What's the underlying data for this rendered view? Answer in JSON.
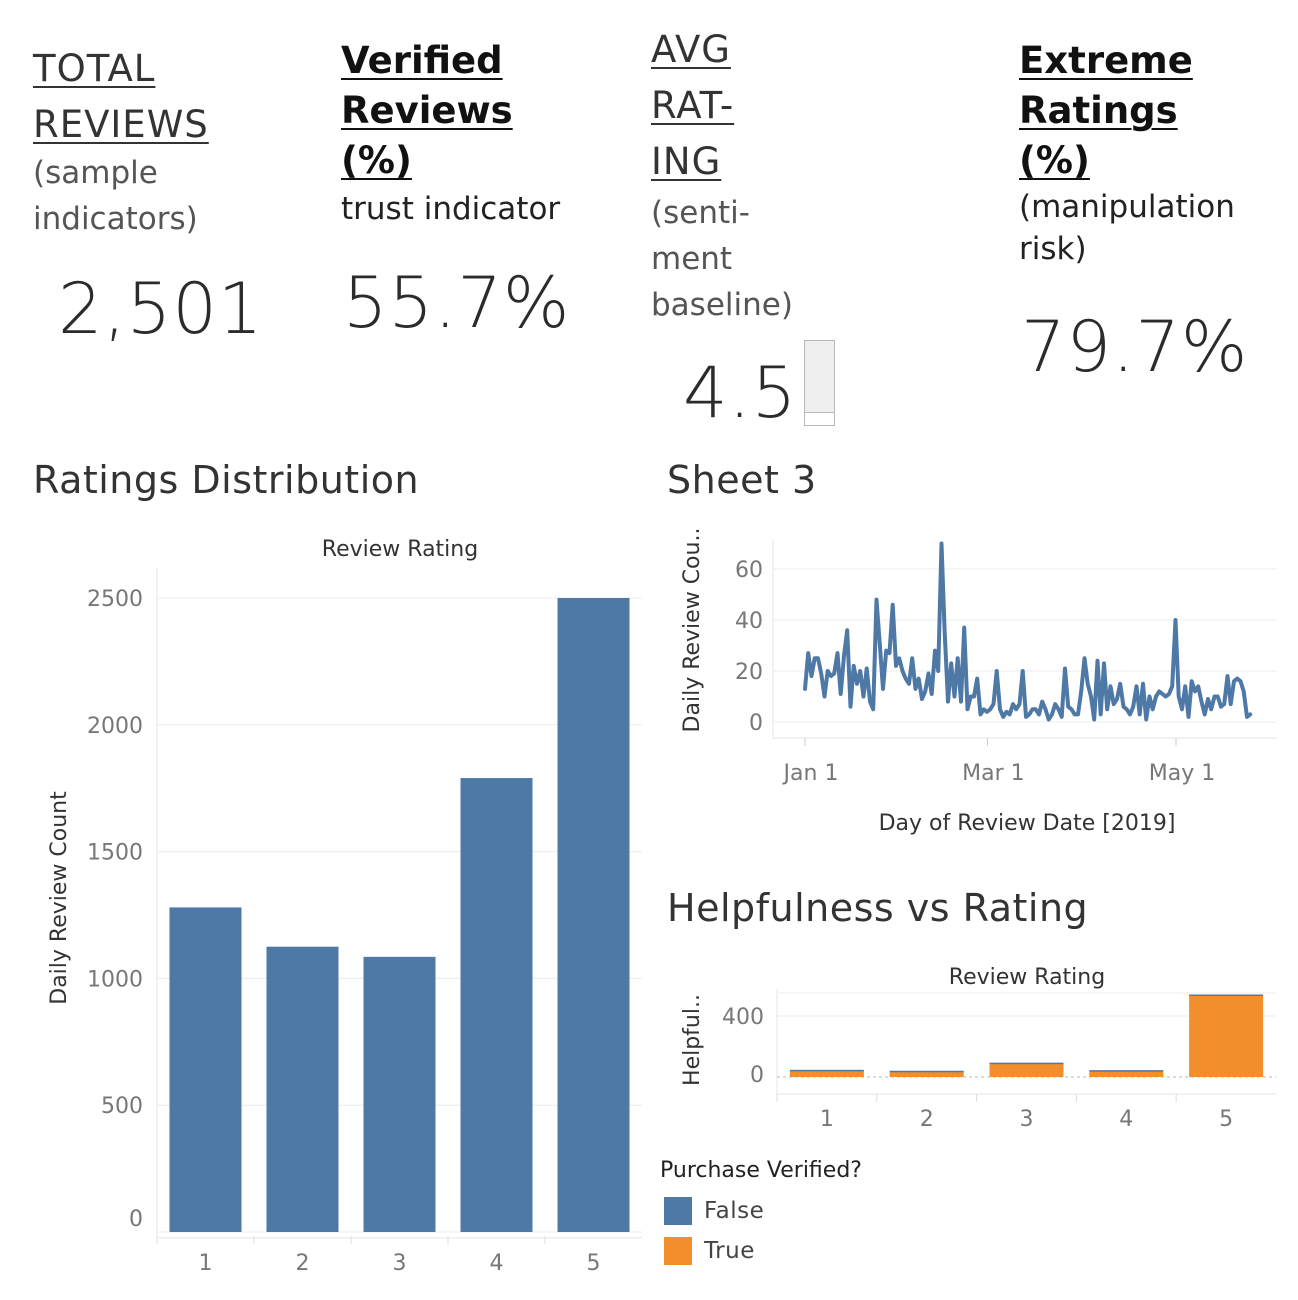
{
  "kpis": {
    "total": {
      "title_1": "TOTAL",
      "title_2": "REVIEWS",
      "sub_1": "(sample",
      "sub_2": "indicators)",
      "value": "2,501"
    },
    "verified": {
      "title_1": "Verified",
      "title_2": "Reviews",
      "title_3": "(%)",
      "sub_1": "trust indicator",
      "value": "55.7%"
    },
    "avg": {
      "title_1": "AVG",
      "title_2": "RAT-",
      "title_3": "ING",
      "sub_1": "(senti-",
      "sub_2": "ment",
      "sub_3": "baseline)",
      "value": "4.5"
    },
    "extreme": {
      "title_1": "Extreme",
      "title_2": "Ratings",
      "title_3": "(%)",
      "sub_1": "(manipulation",
      "sub_2": "risk)",
      "value": "79.7%"
    }
  },
  "sheets": {
    "ratings_title": "Ratings Distribution",
    "sheet3_title": "Sheet 3",
    "helpfulness_title": "Helpfulness vs Rating"
  },
  "legend": {
    "title": "Purchase Verified?",
    "items": [
      {
        "label": "False",
        "color": "#4e79a7"
      },
      {
        "label": "True",
        "color": "#f28e2b"
      }
    ]
  },
  "chart_data": [
    {
      "id": "ratings",
      "type": "bar",
      "title": "Ratings Distribution",
      "xlabel": "Review Rating",
      "ylabel": "Daily Review Count",
      "categories": [
        "1",
        "2",
        "3",
        "4",
        "5"
      ],
      "values": [
        1280,
        1125,
        1085,
        1790,
        2500
      ],
      "ylim": [
        0,
        2500
      ],
      "yticks": [
        0,
        500,
        1000,
        1500,
        2000,
        2500
      ],
      "color": "#4e79a7",
      "grid": true
    },
    {
      "id": "sheet3",
      "type": "line",
      "title": "Sheet 3",
      "xlabel": "Day of Review Date [2019]",
      "ylabel": "Daily Review Cou..",
      "xticks": [
        "Jan 1",
        "Mar 1",
        "May 1"
      ],
      "yticks": [
        0,
        20,
        40,
        60
      ],
      "x_start": "2019-01-01",
      "x_end": "2019-05-25",
      "values": [
        13,
        27,
        18,
        25,
        25,
        19,
        10,
        20,
        18,
        19,
        27,
        11,
        26,
        36,
        6,
        22,
        15,
        20,
        10,
        21,
        8,
        5,
        48,
        31,
        13,
        28,
        27,
        46,
        22,
        25,
        20,
        17,
        15,
        25,
        13,
        17,
        9,
        12,
        19,
        11,
        28,
        20,
        70,
        35,
        8,
        23,
        10,
        25,
        8,
        37,
        5,
        10,
        10,
        17,
        3,
        5,
        4,
        5,
        7,
        20,
        5,
        2,
        4,
        3,
        7,
        5,
        7,
        20,
        2,
        3,
        5,
        5,
        3,
        8,
        5,
        1,
        3,
        7,
        5,
        2,
        21,
        6,
        5,
        3,
        3,
        12,
        25,
        15,
        10,
        1,
        24,
        3,
        23,
        5,
        14,
        7,
        9,
        15,
        6,
        5,
        3,
        6,
        14,
        3,
        15,
        1,
        10,
        5,
        10,
        12,
        11,
        10,
        11,
        14,
        40,
        10,
        5,
        14,
        2,
        16,
        12,
        14,
        8,
        3,
        9,
        5,
        10,
        10,
        6,
        7,
        18,
        7,
        16,
        17,
        16,
        12,
        2,
        3
      ]
    },
    {
      "id": "helpfulness",
      "type": "bar",
      "stacked": true,
      "title": "Helpfulness vs Rating",
      "xlabel": "Review Rating",
      "ylabel": "Helpful..",
      "categories": [
        "1",
        "2",
        "3",
        "4",
        "5"
      ],
      "yticks": [
        0,
        400
      ],
      "ylim": [
        0,
        540
      ],
      "series": [
        {
          "name": "True",
          "values": [
            42,
            36,
            87,
            40,
            535
          ],
          "color": "#f28e2b"
        },
        {
          "name": "False",
          "values": [
            5,
            5,
            7,
            5,
            6
          ],
          "color": "#4e79a7"
        }
      ]
    }
  ]
}
